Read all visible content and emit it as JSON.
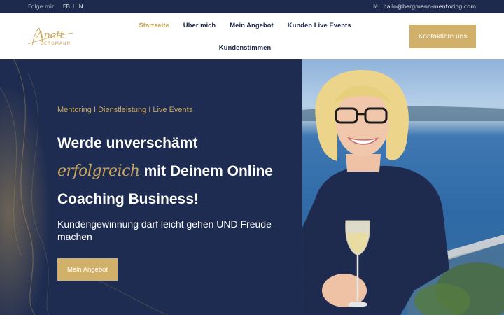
{
  "topbar": {
    "follow_label": "Folge mir:",
    "socials": [
      "FB",
      "IN"
    ],
    "separator": "I",
    "mail_prefix": "M:",
    "email": "hallo@bergmann-mentoring.com"
  },
  "logo": {
    "script": "Anett",
    "caps": "BERGMANN"
  },
  "nav": {
    "items": [
      {
        "label": "Startseite",
        "active": true
      },
      {
        "label": "Über mich",
        "active": false
      },
      {
        "label": "Mein Angebot",
        "active": false
      },
      {
        "label": "Kunden Live Events",
        "active": false
      },
      {
        "label": "Kundenstimmen",
        "active": false
      }
    ],
    "cta_label": "Kontaktiere uns"
  },
  "hero": {
    "kicker": "Mentoring I Dienstleistung I Live Events",
    "headline_line1": "Werde unverschämt",
    "headline_script": "erfolgreich",
    "headline_line2_rest": "mit Deinem Online",
    "headline_line3": "Coaching Business!",
    "subtitle": "Kundengewinnung darf leicht gehen UND Freude machen",
    "button_label": "Mein Angebot"
  },
  "colors": {
    "navy": "#1e2c51",
    "topbar": "#1d2a4d",
    "gold": "#d1b06a",
    "gold_text": "#c9a55a"
  }
}
